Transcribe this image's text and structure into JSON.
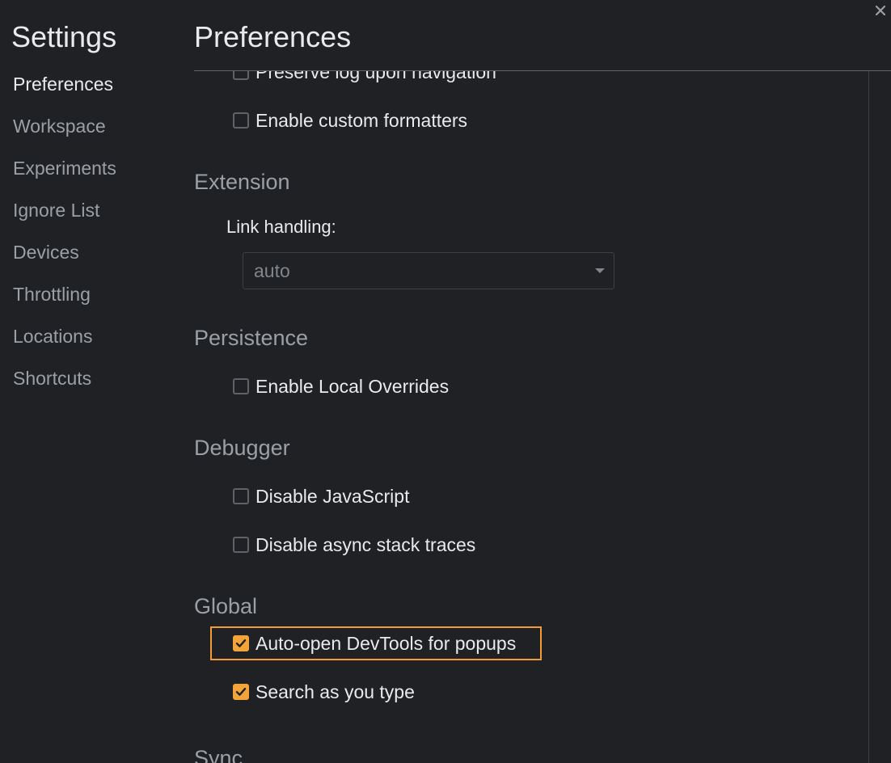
{
  "sidebar": {
    "title": "Settings",
    "items": [
      {
        "label": "Preferences",
        "active": true
      },
      {
        "label": "Workspace"
      },
      {
        "label": "Experiments"
      },
      {
        "label": "Ignore List"
      },
      {
        "label": "Devices"
      },
      {
        "label": "Throttling"
      },
      {
        "label": "Locations"
      },
      {
        "label": "Shortcuts"
      }
    ]
  },
  "main": {
    "title": "Preferences",
    "close_icon": "close-icon",
    "preserve_log": {
      "label": "Preserve log upon navigation",
      "checked": false
    },
    "custom_formatters": {
      "label": "Enable custom formatters",
      "checked": false
    },
    "extension": {
      "title": "Extension",
      "link_handling_label": "Link handling:",
      "link_handling_value": "auto"
    },
    "persistence": {
      "title": "Persistence",
      "local_overrides": {
        "label": "Enable Local Overrides",
        "checked": false
      }
    },
    "debugger": {
      "title": "Debugger",
      "disable_js": {
        "label": "Disable JavaScript",
        "checked": false
      },
      "disable_async": {
        "label": "Disable async stack traces",
        "checked": false
      }
    },
    "global": {
      "title": "Global",
      "auto_open": {
        "label": "Auto-open DevTools for popups",
        "checked": true
      },
      "search_as_type": {
        "label": "Search as you type",
        "checked": true
      }
    },
    "sync": {
      "title": "Sync"
    }
  },
  "colors": {
    "accent": "#f2a33a",
    "background": "#202124",
    "text": "#e8eaed",
    "muted": "#9aa0a6",
    "highlight_border": "#f29c38"
  }
}
